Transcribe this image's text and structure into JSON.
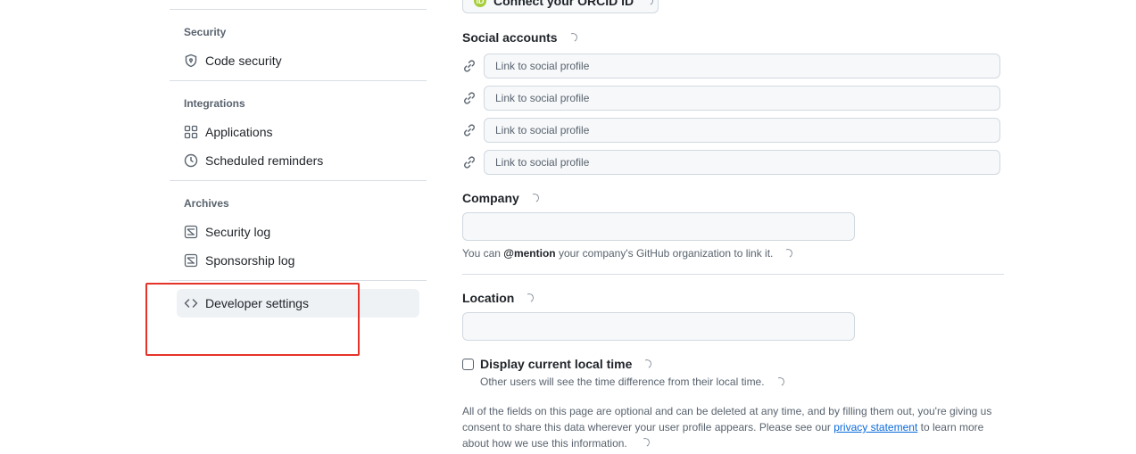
{
  "sidebar": {
    "sections": [
      {
        "title": "Security",
        "items": [
          {
            "label": "Code security",
            "icon": "shield-icon"
          }
        ]
      },
      {
        "title": "Integrations",
        "items": [
          {
            "label": "Applications",
            "icon": "apps-grid-icon"
          },
          {
            "label": "Scheduled reminders",
            "icon": "clock-icon"
          }
        ]
      },
      {
        "title": "Archives",
        "items": [
          {
            "label": "Security log",
            "icon": "log-icon"
          },
          {
            "label": "Sponsorship log",
            "icon": "log-icon"
          }
        ]
      }
    ],
    "developer_settings": {
      "label": "Developer settings",
      "icon": "code-icon"
    },
    "highlight_color": "#e5332a"
  },
  "main": {
    "orcid_button": "Connect your ORCID iD",
    "social_accounts": {
      "label": "Social accounts",
      "placeholder": "Link to social profile",
      "icon": "link-icon"
    },
    "company": {
      "label": "Company",
      "value": "",
      "hint_prefix": "You can ",
      "hint_mention": "@mention",
      "hint_suffix": " your company's GitHub organization to link it."
    },
    "location": {
      "label": "Location",
      "value": ""
    },
    "local_time": {
      "label": "Display current local time",
      "checked": false,
      "hint": "Other users will see the time difference from their local time."
    },
    "footer": {
      "text_before": "All of the fields on this page are optional and can be deleted at any time, and by filling them out, you're giving us consent to share this data wherever your user profile appears. Please see our ",
      "link_text": "privacy statement",
      "text_after": " to learn more about how we use this information."
    }
  },
  "colors": {
    "accent_link": "#0969da",
    "orcid_green": "#a6ce39"
  }
}
